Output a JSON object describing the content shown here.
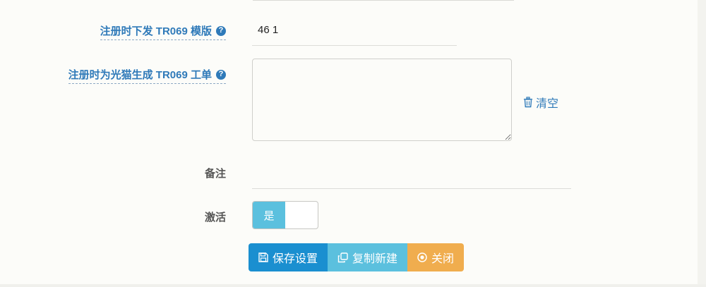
{
  "form": {
    "tr069_template_label": "注册时下发 TR069 模版",
    "tr069_template_value": "46 1",
    "tr069_workorder_label": "注册时为光猫生成 TR069 工单",
    "workorder_value": "",
    "clear_label": "清空",
    "remark_label": "备注",
    "remark_value": "",
    "active_label": "激活",
    "active_toggle_label": "是"
  },
  "actions": {
    "save_label": "保存设置",
    "copy_label": "复制新建",
    "close_label": "关闭"
  },
  "colors": {
    "link": "#2f7ab9",
    "save": "#1a8fd0",
    "info": "#5bc0de",
    "warning": "#f0ad4e"
  }
}
